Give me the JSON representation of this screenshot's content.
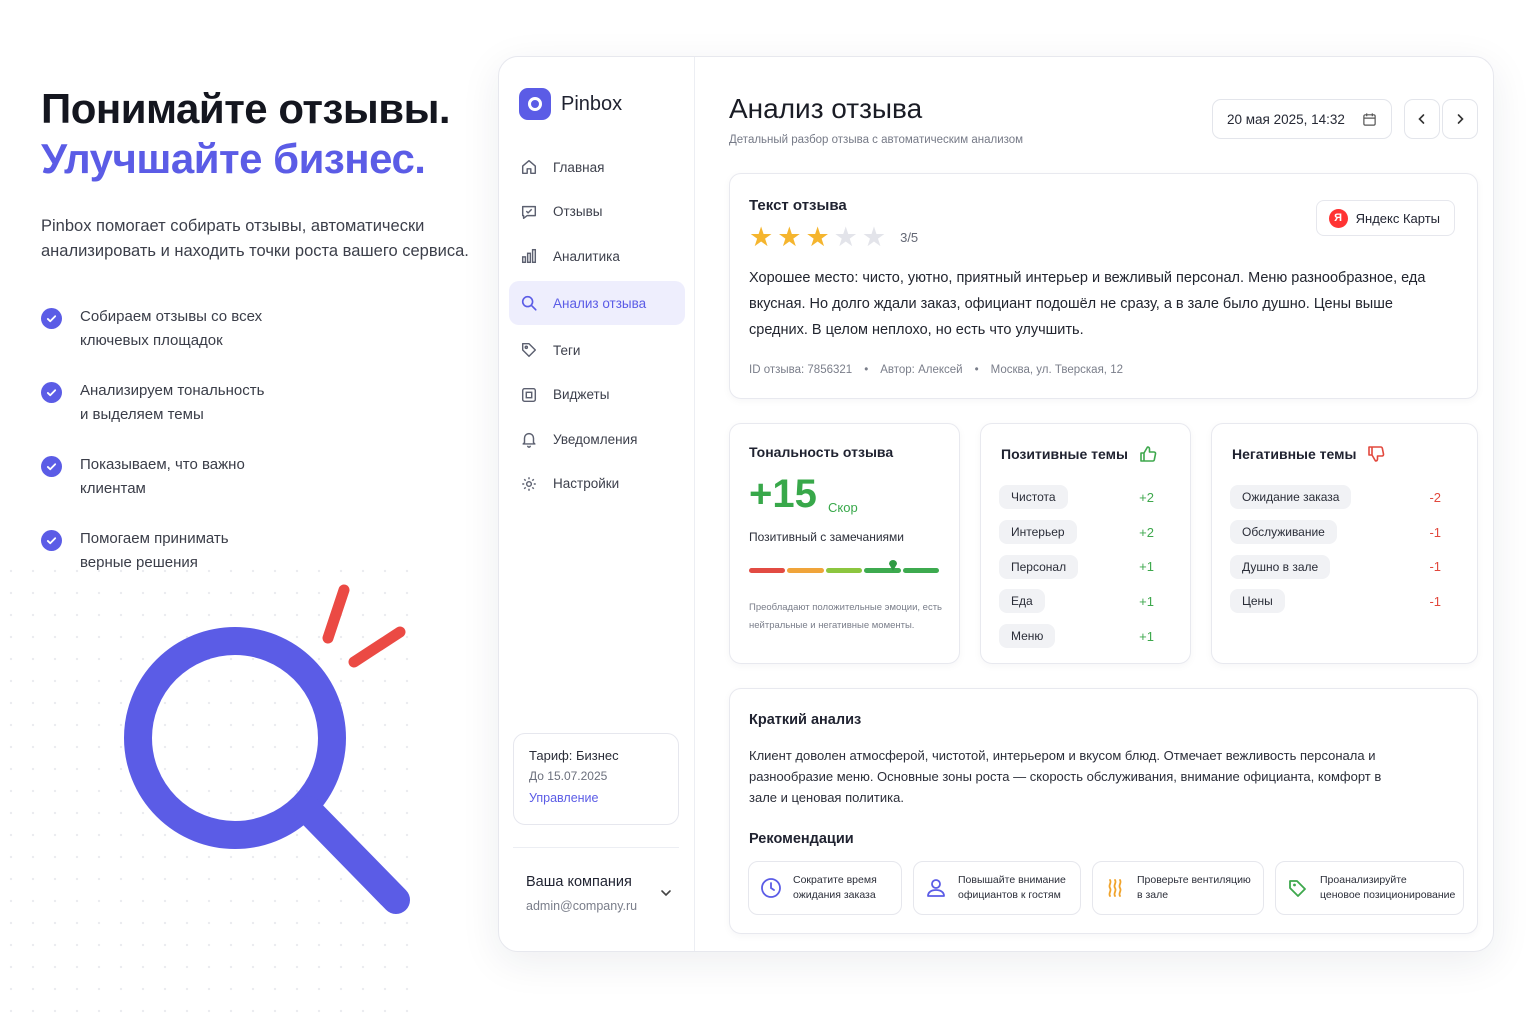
{
  "hero": {
    "title_line1": "Понимайте отзывы.",
    "title_line2": "Улучшайте бизнес.",
    "lead": "Pinbox помогает собирать отзывы, автоматически анализировать и находить точки роста вашего сервиса.",
    "features": [
      "Собираем отзывы со всех\nключевых площадок",
      "Анализируем тональность\nи выделяем темы",
      "Показываем, что важно\nклиентам",
      "Помогаем принимать\nверные решения"
    ]
  },
  "brand": {
    "name": "Pinbox"
  },
  "nav": [
    {
      "label": "Главная",
      "icon": "home-icon"
    },
    {
      "label": "Отзывы",
      "icon": "chat-icon"
    },
    {
      "label": "Аналитика",
      "icon": "bar-chart-icon"
    },
    {
      "label": "Анализ отзыва",
      "icon": "search-icon",
      "active": true
    },
    {
      "label": "Теги",
      "icon": "tag-icon"
    },
    {
      "label": "Виджеты",
      "icon": "widget-icon"
    },
    {
      "label": "Уведомления",
      "icon": "bell-icon"
    },
    {
      "label": "Настройки",
      "icon": "gear-icon"
    }
  ],
  "plan": {
    "title": "Тариф: Бизнес",
    "until": "До 15.07.2025",
    "manage": "Управление"
  },
  "company": {
    "name": "Ваша компания",
    "email": "admin@company.ru"
  },
  "page": {
    "title": "Анализ отзыва",
    "subtitle": "Детальный разбор отзыва с автоматическим анализом",
    "date": "20 мая 2025, 14:32"
  },
  "review": {
    "heading": "Текст отзыва",
    "rating": 3,
    "rating_max": 5,
    "rating_text": "3/5",
    "source": "Яндекс Карты",
    "source_logo": "Я",
    "text": "Хорошее место: чисто, уютно, приятный интерьер и вежливый персонал. Меню разнообразное, еда вкусная. Но долго ждали заказ, официант подошёл не сразу, а в зале было душно. Цены выше средних. В целом неплохо, но есть что улучшить.",
    "id": "ID отзыва: 7856321",
    "author": "Автор: Алексей",
    "location": "Москва, ул. Тверская, 12"
  },
  "tone": {
    "heading": "Тональность отзыва",
    "score": "+15",
    "score_label": "Скор",
    "summary": "Позитивный с замечаниями",
    "note": "Преобладают положительные эмоции, есть нейтральные и негативные моменты.",
    "scale_colors": [
      "#e24b43",
      "#f0a43a",
      "#8cc63f",
      "#3daa4f",
      "#3daa4f"
    ],
    "marker_position": 0.75
  },
  "positive": {
    "heading": "Позитивные темы",
    "items": [
      {
        "label": "Чистота",
        "value": "+2"
      },
      {
        "label": "Интерьер",
        "value": "+2"
      },
      {
        "label": "Персонал",
        "value": "+1"
      },
      {
        "label": "Еда",
        "value": "+1"
      },
      {
        "label": "Меню",
        "value": "+1"
      }
    ]
  },
  "negative": {
    "heading": "Негативные темы",
    "items": [
      {
        "label": "Ожидание заказа",
        "value": "-2"
      },
      {
        "label": "Обслуживание",
        "value": "-1"
      },
      {
        "label": "Душно в зале",
        "value": "-1"
      },
      {
        "label": "Цены",
        "value": "-1"
      }
    ]
  },
  "brief": {
    "heading": "Краткий анализ",
    "text": "Клиент доволен атмосферой, чистотой, интерьером и вкусом блюд. Отмечает вежливость персонала и разнообразие меню. Основные зоны роста — скорость обслуживания, внимание официанта, комфорт в зале и ценовая политика.",
    "rec_heading": "Рекомендации",
    "recs": [
      {
        "line1": "Сократите время",
        "line2": "ожидания заказа",
        "icon": "clock-icon"
      },
      {
        "line1": "Повышайте внимание",
        "line2": "официантов к гостям",
        "icon": "user-icon"
      },
      {
        "line1": "Проверьте вентиляцию",
        "line2": "в зале",
        "icon": "heat-icon"
      },
      {
        "line1": "Проанализируйте",
        "line2": "ценовое позиционирование",
        "icon": "price-tag-icon"
      }
    ]
  },
  "colors": {
    "accent": "#5b5ce6",
    "positive": "#3ea84d",
    "negative": "#e2483d",
    "star": "#f5b52e"
  }
}
